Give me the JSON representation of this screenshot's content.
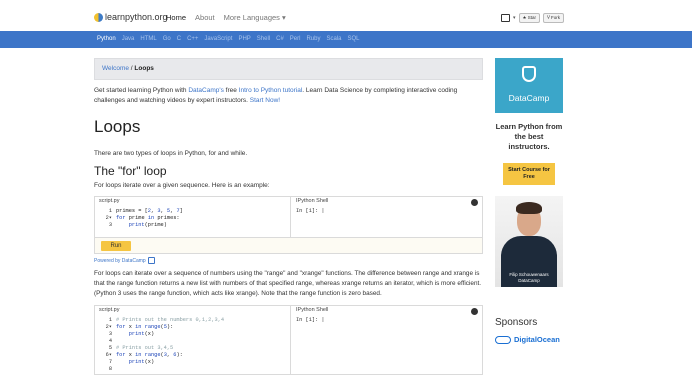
{
  "brand": {
    "logo_text": "learnpython.org"
  },
  "topnav": {
    "home": "Home",
    "about": "About",
    "more": "More Languages"
  },
  "github": {
    "star": "★ Star",
    "fork": "Ⴤ Fork"
  },
  "languages": [
    "Python",
    "Java",
    "HTML",
    "Go",
    "C",
    "C++",
    "JavaScript",
    "PHP",
    "Shell",
    "C#",
    "Perl",
    "Ruby",
    "Scala",
    "SQL"
  ],
  "active_language": "Python",
  "breadcrumb": {
    "home": "Welcome",
    "sep": " / ",
    "current": "Loops"
  },
  "intro": {
    "t1": "Get started learning Python with ",
    "l1": "DataCamp's",
    "t2": " free ",
    "l2": "Intro to Python tutorial",
    "t3": ". Learn Data Science by completing interactive coding challenges and watching videos by expert instructors. ",
    "l3": "Start Now!"
  },
  "page_title": "Loops",
  "p1": "There are two types of loops in Python, for and while.",
  "h2_for": "The \"for\" loop",
  "p2": "For loops iterate over a given sequence. Here is an example:",
  "widget1": {
    "tab": "script.py",
    "shell_tab": "IPython Shell",
    "prompt": "In [1]: |"
  },
  "widget2": {
    "tab": "script.py",
    "shell_tab": "IPython Shell",
    "prompt": "In [1]: |"
  },
  "run_label": "Run",
  "powered": "Powered by DataCamp",
  "p3": "For loops can iterate over a sequence of numbers using the \"range\" and \"xrange\" functions. The difference between range and xrange is that the range function returns a new list with numbers of that specified range, whereas xrange returns an iterator, which is more efficient. (Python 3 uses the range function, which acts like xrange). Note that the range function is zero based.",
  "ad": {
    "brand": "DataCamp",
    "headline": "Learn Python from the best instructors.",
    "button": "Start Course for Free",
    "caption_name": "Filip Schouwenaars",
    "caption_org": "DataCamp"
  },
  "sponsors": {
    "title": "Sponsors",
    "logo": "DigitalOcean"
  },
  "colors": {
    "langbar": "#3d75c8",
    "link": "#3d75c8",
    "run": "#f5c542",
    "ad": "#3ba6c9"
  }
}
